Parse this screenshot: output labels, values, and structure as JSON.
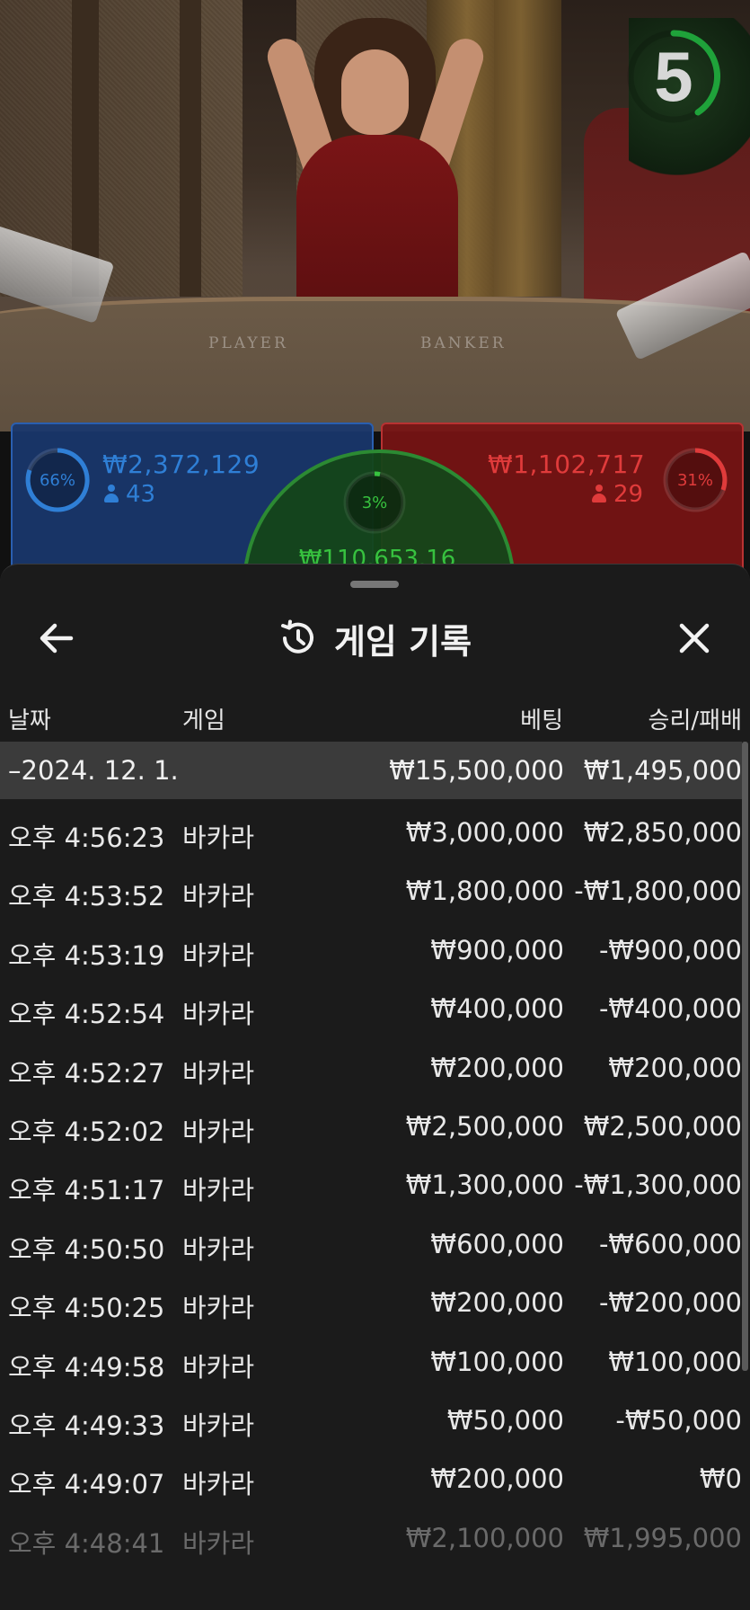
{
  "countdown": {
    "value": "5",
    "ring_color": "#1fa23a"
  },
  "bets": {
    "player": {
      "percent": "66%",
      "amount": "₩2,372,129",
      "players": "43",
      "color": "#2f7fd6"
    },
    "banker": {
      "percent": "31%",
      "amount": "₩1,102,717",
      "players": "29",
      "color": "#e03b3b"
    },
    "tie": {
      "percent": "3%",
      "amount": "₩110,653.16",
      "color": "#37c23f"
    }
  },
  "table_labels": {
    "player": "PLAYER",
    "banker": "BANKER"
  },
  "sheet": {
    "title": "게임 기록",
    "icons": {
      "back": "arrow-left-icon",
      "history": "history-icon",
      "close": "close-icon"
    },
    "columns": {
      "date": "날짜",
      "game": "게임",
      "bet": "베팅",
      "result": "승리/패배"
    },
    "date_group": {
      "label": "–2024. 12. 1.",
      "bet_total": "₩15,500,000",
      "result_total": "₩1,495,000"
    },
    "rows": [
      {
        "time": "오후 4:56:23",
        "game": "바카라",
        "bet": "₩3,000,000",
        "result": "₩2,850,000"
      },
      {
        "time": "오후 4:53:52",
        "game": "바카라",
        "bet": "₩1,800,000",
        "result": "-₩1,800,000"
      },
      {
        "time": "오후 4:53:19",
        "game": "바카라",
        "bet": "₩900,000",
        "result": "-₩900,000"
      },
      {
        "time": "오후 4:52:54",
        "game": "바카라",
        "bet": "₩400,000",
        "result": "-₩400,000"
      },
      {
        "time": "오후 4:52:27",
        "game": "바카라",
        "bet": "₩200,000",
        "result": "₩200,000"
      },
      {
        "time": "오후 4:52:02",
        "game": "바카라",
        "bet": "₩2,500,000",
        "result": "₩2,500,000"
      },
      {
        "time": "오후 4:51:17",
        "game": "바카라",
        "bet": "₩1,300,000",
        "result": "-₩1,300,000"
      },
      {
        "time": "오후 4:50:50",
        "game": "바카라",
        "bet": "₩600,000",
        "result": "-₩600,000"
      },
      {
        "time": "오후 4:50:25",
        "game": "바카라",
        "bet": "₩200,000",
        "result": "-₩200,000"
      },
      {
        "time": "오후 4:49:58",
        "game": "바카라",
        "bet": "₩100,000",
        "result": "₩100,000"
      },
      {
        "time": "오후 4:49:33",
        "game": "바카라",
        "bet": "₩50,000",
        "result": "-₩50,000"
      },
      {
        "time": "오후 4:49:07",
        "game": "바카라",
        "bet": "₩200,000",
        "result": "₩0"
      },
      {
        "time": "오후 4:48:41",
        "game": "바카라",
        "bet": "₩2,100,000",
        "result": "₩1,995,000"
      }
    ]
  }
}
